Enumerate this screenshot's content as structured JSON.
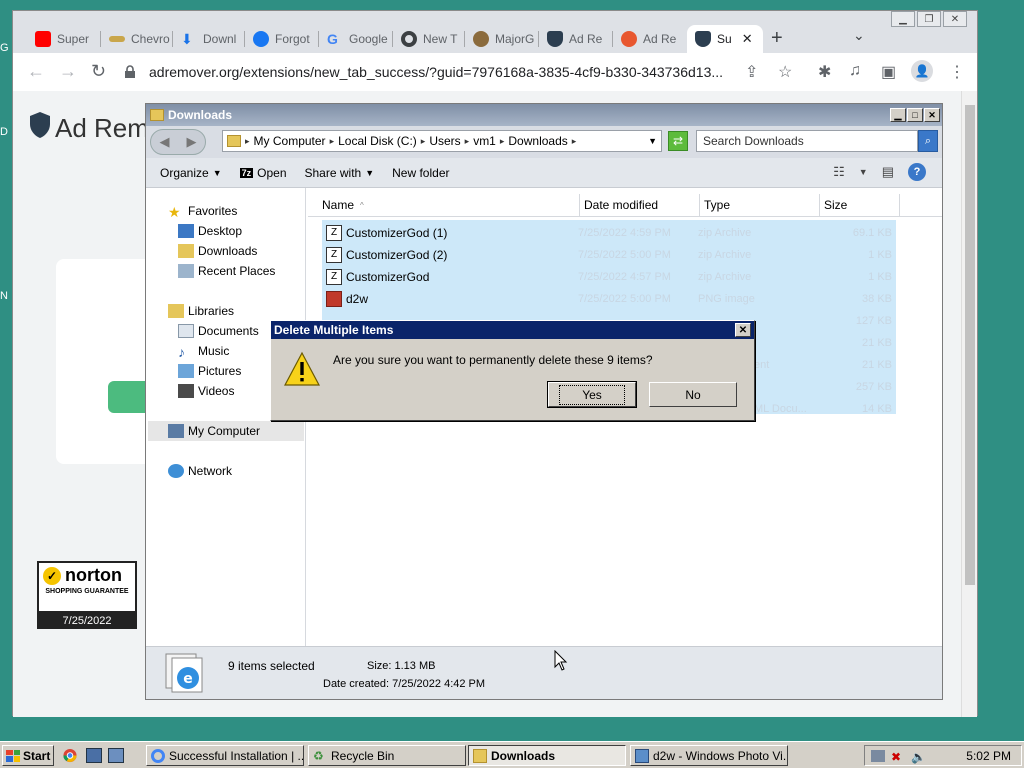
{
  "browser": {
    "tabs": [
      {
        "label": "Super",
        "icon": "youtube-icon",
        "color": "#ff0000"
      },
      {
        "label": "Chevro",
        "icon": "chevrolet-icon",
        "color": "#c9a64b"
      },
      {
        "label": "Downl",
        "icon": "download-icon",
        "color": "#1a73e8"
      },
      {
        "label": "Forgot",
        "icon": "facebook-icon",
        "color": "#1877f2"
      },
      {
        "label": "Google",
        "icon": "google-icon",
        "color": "#4285f4"
      },
      {
        "label": "New T",
        "icon": "chrome-icon",
        "color": "#3c4043"
      },
      {
        "label": "MajorG",
        "icon": "majorgeeks-icon",
        "color": "#8b6b3d"
      },
      {
        "label": "Ad Re",
        "icon": "adremover-shield-icon",
        "color": "#2c3e50"
      },
      {
        "label": "Ad Re",
        "icon": "adremover-icon",
        "color": "#e8572f"
      },
      {
        "label": "Su",
        "icon": "adremover-shield-icon",
        "color": "#2c3e50",
        "active": true
      }
    ],
    "url": "adremover.org/extensions/new_tab_success/?guid=7976168a-3835-4cf9-b330-343736d13...",
    "page_brand": "Ad Rem",
    "norton": {
      "name": "norton",
      "sub": "SHOPPING GUARANTEE",
      "date": "7/25/2022"
    }
  },
  "explorer": {
    "title": "Downloads",
    "breadcrumb": [
      "My Computer",
      "Local Disk (C:)",
      "Users",
      "vm1",
      "Downloads"
    ],
    "search_placeholder": "Search Downloads",
    "commands": {
      "organize": "Organize",
      "open": "Open",
      "share": "Share with",
      "new_folder": "New folder"
    },
    "nav": {
      "favorites": "Favorites",
      "desktop": "Desktop",
      "downloads": "Downloads",
      "recent": "Recent Places",
      "libraries": "Libraries",
      "documents": "Documents",
      "music": "Music",
      "pictures": "Pictures",
      "videos": "Videos",
      "computer": "My Computer",
      "network": "Network"
    },
    "columns": {
      "name": "Name",
      "date": "Date modified",
      "type": "Type",
      "size": "Size"
    },
    "files": [
      {
        "name": "CustomizerGod (1)",
        "date": "7/25/2022 4:59 PM",
        "type": "zip Archive",
        "size": "69.1 KB"
      },
      {
        "name": "CustomizerGod (2)",
        "date": "7/25/2022 5:00 PM",
        "type": "zip Archive",
        "size": "1 KB"
      },
      {
        "name": "CustomizerGod",
        "date": "7/25/2022 4:57 PM",
        "type": "zip Archive",
        "size": "1 KB"
      },
      {
        "name": "d2w",
        "date": "7/25/2022 5:00 PM",
        "type": "PNG image",
        "size": "38 KB"
      }
    ],
    "hidden_sizes": [
      "127 KB",
      "21 KB",
      "21 KB",
      "257 KB",
      "14 KB"
    ],
    "hidden_types": [
      "ent",
      "ML Docu..."
    ],
    "status": {
      "selected": "9 items selected",
      "size_label": "Size: 1.13 MB",
      "created": "Date created: 7/25/2022 4:42 PM"
    }
  },
  "dialog": {
    "title": "Delete Multiple Items",
    "message": "Are you sure you want to permanently delete these 9 items?",
    "yes": "Yes",
    "no": "No"
  },
  "taskbar": {
    "start": "Start",
    "tasks": [
      {
        "label": "Successful Installation | ...",
        "icon": "chrome-icon"
      },
      {
        "label": "Recycle Bin",
        "icon": "recycle-bin-icon"
      },
      {
        "label": "Downloads",
        "icon": "folder-icon",
        "active": true
      },
      {
        "label": "d2w - Windows Photo Vi...",
        "icon": "photo-viewer-icon"
      }
    ],
    "clock": "5:02 PM"
  },
  "colors": {
    "dialog_title": "#0a246a",
    "desktop": "#2f8f83",
    "selection": "#cde8f9"
  }
}
